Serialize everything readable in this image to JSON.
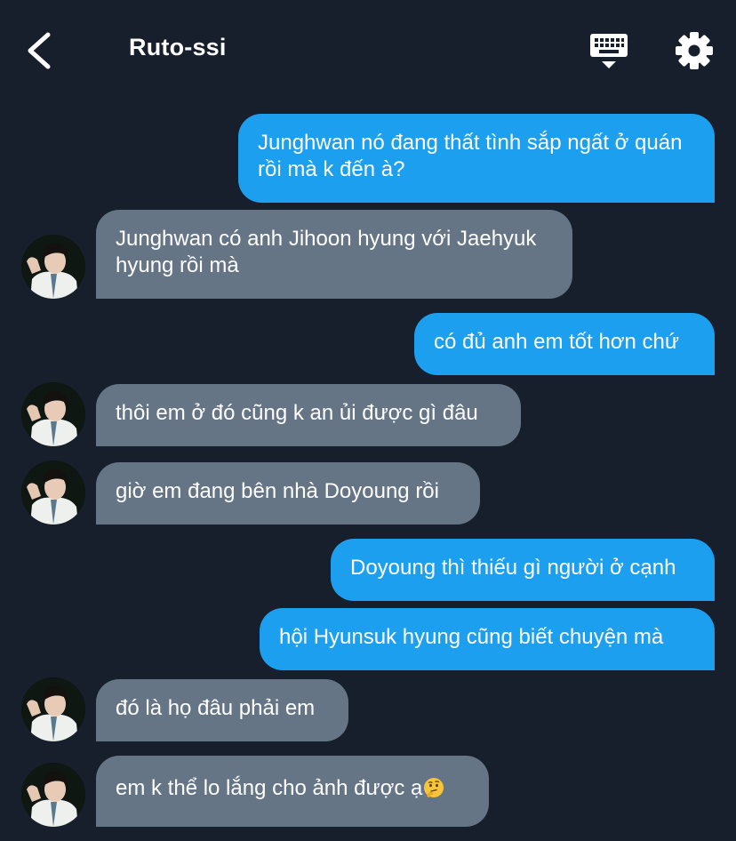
{
  "header": {
    "title": "Ruto-ssi",
    "back_icon": "chevron-left-icon",
    "keyboard_icon": "keyboard-icon",
    "settings_icon": "gear-icon"
  },
  "colors": {
    "background": "#161f2b",
    "outgoing_bubble": "#1d9ff0",
    "incoming_bubble": "#657585",
    "text": "#ffffff"
  },
  "messages": [
    {
      "side": "out",
      "text": "Junghwan nó đang thất tình sắp ngất ở quán rồi mà k đến à?"
    },
    {
      "side": "in",
      "text": "Junghwan có anh Jihoon hyung với Jaehyuk hyung rồi mà"
    },
    {
      "side": "out",
      "text": "có đủ anh em tốt hơn chứ"
    },
    {
      "side": "in",
      "text": "thôi em ở đó cũng k an ủi được gì đâu"
    },
    {
      "side": "in",
      "text": "giờ em đang bên nhà Doyoung rồi"
    },
    {
      "side": "out",
      "text": "Doyoung thì thiếu gì người ở cạnh"
    },
    {
      "side": "out",
      "text": "hội Hyunsuk hyung cũng biết chuyện mà"
    },
    {
      "side": "in",
      "text": "đó là họ đâu phải em"
    },
    {
      "side": "in",
      "text": "em k thể lo lắng cho ảnh được ạ",
      "emoji": "thinking-face-emoji"
    }
  ]
}
